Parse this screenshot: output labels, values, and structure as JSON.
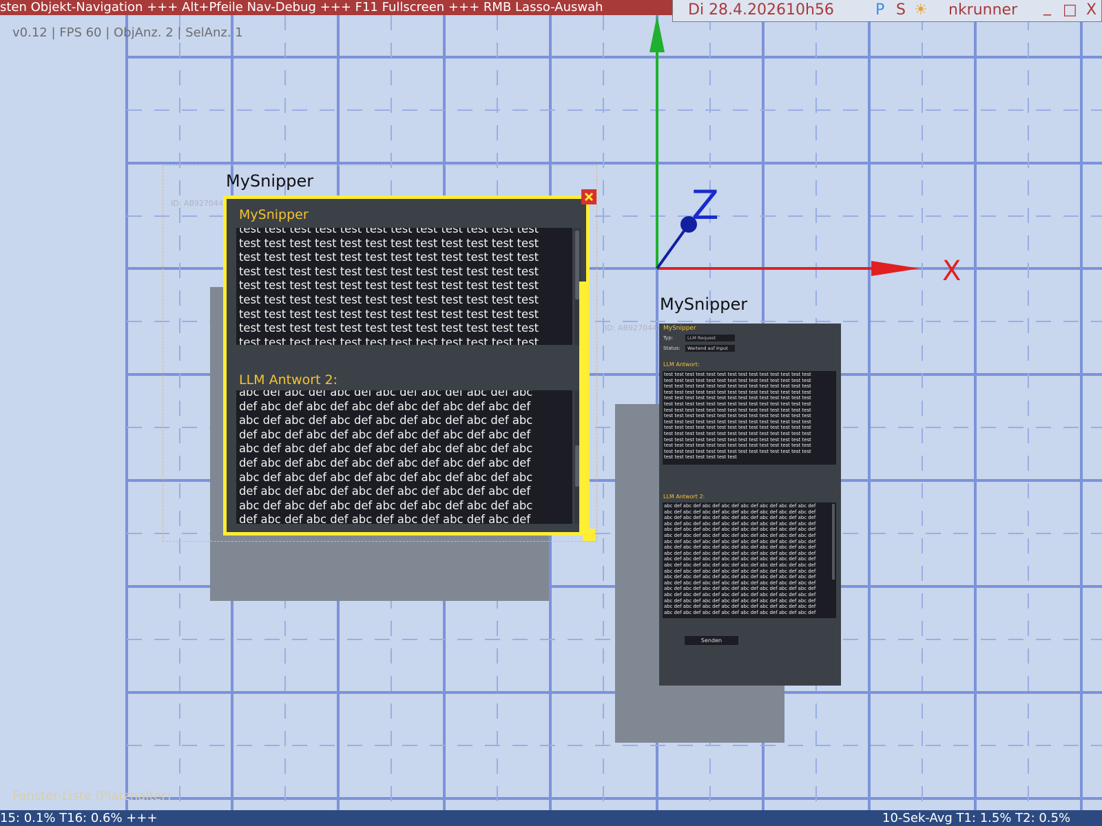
{
  "top_bar": {
    "marquee": "sten Objekt-Navigation +++ Alt+Pfeile Nav-Debug +++ F11 Fullscreen +++ RMB Lasso-Auswah",
    "date": "Di 28.4.2026",
    "time": "10h56",
    "indicator_p": "P",
    "indicator_s": "S",
    "sun_icon": "☀",
    "user": "nkrunner",
    "minimize": "_",
    "maximize": "□",
    "close": "X",
    "colors": {
      "marquee_bg": "#a83a3a",
      "indicator_p": "#3a8ee6",
      "sun": "#f0a020"
    }
  },
  "stats": "v0.12 | FPS 60 | ObjAnz. 2 | SelAnz. 1",
  "axes": {
    "x_label": "X",
    "z_label": "Z",
    "colors": {
      "x": "#e02020",
      "y": "#20b030",
      "z": "#1020a0"
    }
  },
  "window1": {
    "outer_title": "MySnipper",
    "id_label": "ID: AB927044",
    "inner_title": "MySnipper",
    "text_first": "test test test test test test test test test test test test",
    "text_line": "test test test test test test test test test test test test",
    "text_rows": 9,
    "section2": "LLM Antwort 2:",
    "answer_first": "abc def abc def abc def abc def abc def abc def abc",
    "answer_lines": [
      "def abc def abc def abc def abc def abc def abc def",
      "abc def abc def abc def abc def abc def abc def abc"
    ],
    "answer_rows": 10,
    "selection_color": "#ffee33",
    "close_color": "#d83030"
  },
  "window2": {
    "outer_title": "MySnipper",
    "id_label": "ID: AB927044",
    "inner_title": "MySnipper",
    "typ_label": "Typ:",
    "typ_value": "LLM Request",
    "status_label": "Status:",
    "status_value": "Wartend auf Input",
    "section1": "LLM Antwort:",
    "text_line": "test test test test test test test test test test test test test test",
    "text_rows": 14,
    "text_tail": "test test test test test test test",
    "section2": "LLM Antwort 2:",
    "answer_line": "abc def abc def abc def abc def abc def abc def abc def abc def",
    "answer_rows": 19,
    "send_button": "Senden"
  },
  "bottom_bar": {
    "left": "15:  0.1% T16:  0.6% +++",
    "right": "10-Sek-Avg T1:  1.5% T2:  0.5%"
  },
  "window_list": "Fenster-Liste (Platzhalter)"
}
